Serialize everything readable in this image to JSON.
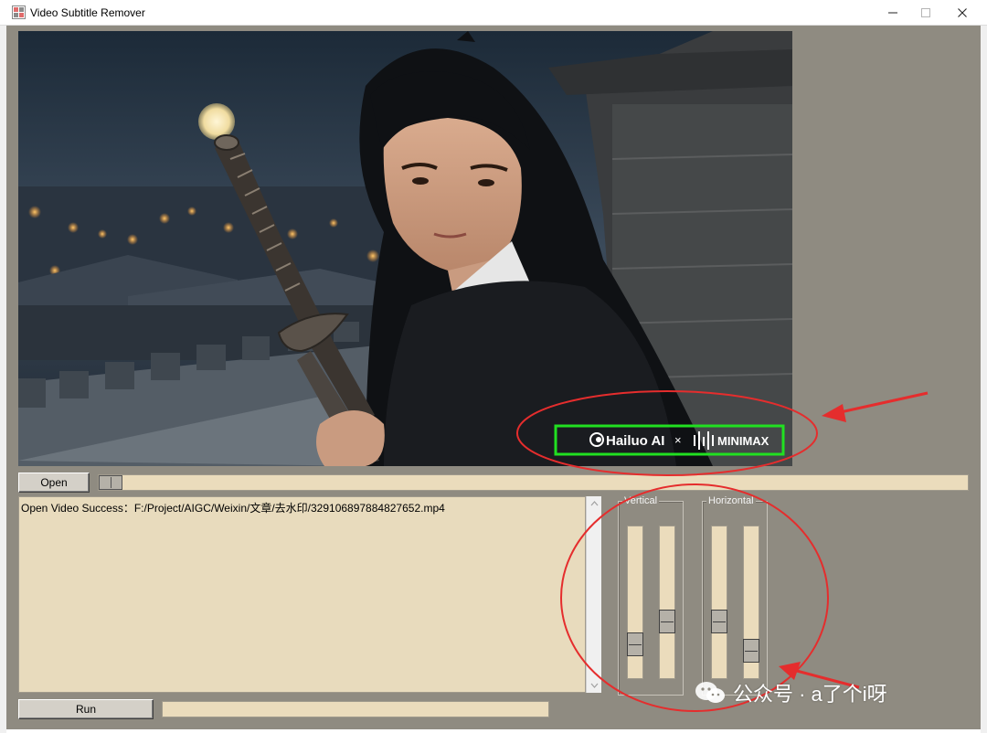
{
  "window": {
    "title": "Video Subtitle Remover",
    "controls": {
      "minimize_icon": "minimize-icon",
      "maximize_icon": "maximize-icon",
      "close_icon": "close-icon"
    }
  },
  "video": {
    "scene": "night-rooftop-swordsman",
    "watermark_brand": "Hailuo AI",
    "watermark_separator": "×",
    "watermark_partner": "MINIMAX",
    "highlight_color": "#21e021"
  },
  "controls": {
    "open_label": "Open",
    "run_label": "Run",
    "seek_progress": 0.0,
    "status_value": ""
  },
  "log": {
    "lines": [
      "Open Video Success：F:/Project/AIGC/Weixin/文章/去水印/329106897884827652.mp4"
    ]
  },
  "sliders": {
    "vertical": {
      "label": "Vertical",
      "values": [
        0.17,
        0.35
      ]
    },
    "horizontal": {
      "label": "Horizontal",
      "values": [
        0.35,
        0.12
      ]
    }
  },
  "annotations": {
    "circle_color": "#e52d2d",
    "arrow_color": "#e52d2d"
  },
  "page_watermark": {
    "text": "公众号 · a了个i呀",
    "icon": "wechat-icon"
  },
  "colors": {
    "client_bg": "#8f8b81",
    "field_bg": "#ebdcbc",
    "button_bg": "#d4d0c8"
  }
}
